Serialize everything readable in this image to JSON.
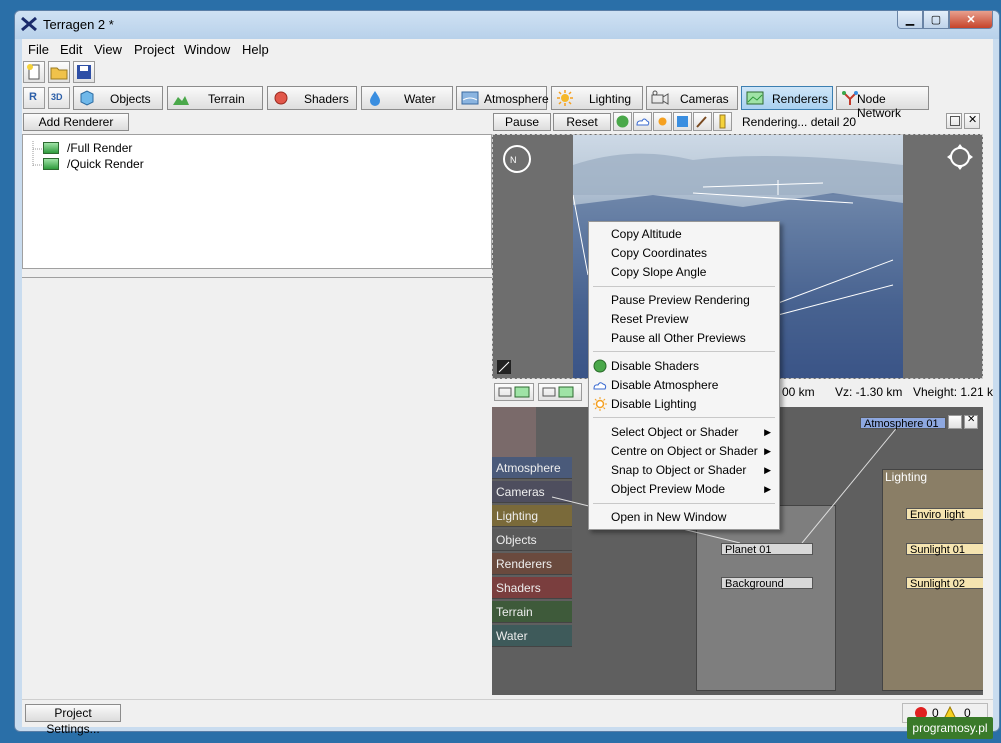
{
  "window": {
    "title": "Terragen 2 *"
  },
  "menu": [
    "File",
    "Edit",
    "View",
    "Project",
    "Window",
    "Help"
  ],
  "tabs": [
    {
      "label": "Objects",
      "icon": "cube-icon"
    },
    {
      "label": "Terrain",
      "icon": "terrain-icon"
    },
    {
      "label": "Shaders",
      "icon": "sphere-icon"
    },
    {
      "label": "Water",
      "icon": "droplet-icon"
    },
    {
      "label": "Atmosphere",
      "icon": "atmosphere-icon"
    },
    {
      "label": "Lighting",
      "icon": "sun-icon"
    },
    {
      "label": "Cameras",
      "icon": "camera-icon"
    },
    {
      "label": "Renderers",
      "icon": "renderer-icon"
    },
    {
      "label": "Node Network",
      "icon": "node-network-icon"
    }
  ],
  "left": {
    "add_renderer": "Add Renderer",
    "tree": [
      "/Full Render",
      "/Quick Render"
    ]
  },
  "preview": {
    "pause": "Pause",
    "reset": "Reset",
    "status": "Rendering... detail 20",
    "readout_1": "00 km",
    "readout_2": "Vz: -1.30 km",
    "readout_3": "Vheight: 1.21 k"
  },
  "context_menu": {
    "group1": [
      "Copy Altitude",
      "Copy Coordinates",
      "Copy Slope Angle"
    ],
    "group2": [
      "Pause Preview Rendering",
      "Reset Preview",
      "Pause all Other Previews"
    ],
    "group3": [
      "Disable Shaders",
      "Disable Atmosphere",
      "Disable Lighting"
    ],
    "group4": [
      "Select Object or Shader",
      "Centre on Object or Shader",
      "Snap to Object or Shader",
      "Object Preview Mode"
    ],
    "group5": [
      "Open in New Window"
    ]
  },
  "node_categories": [
    {
      "label": "Atmosphere",
      "color": "#4a5a7a"
    },
    {
      "label": "Cameras",
      "color": "#4e4e5e"
    },
    {
      "label": "Lighting",
      "color": "#7a6a3a"
    },
    {
      "label": "Objects",
      "color": "#5a5a5a"
    },
    {
      "label": "Renderers",
      "color": "#6a4a3e"
    },
    {
      "label": "Shaders",
      "color": "#7a3e3e"
    },
    {
      "label": "Terrain",
      "color": "#3e5a3a"
    },
    {
      "label": "Water",
      "color": "#3e5a5a"
    }
  ],
  "nodes": {
    "atmosphere": "Atmosphere 01",
    "planet": "Planet 01",
    "background": "Background",
    "lighting_group": "Lighting",
    "enviro": "Enviro light",
    "sun1": "Sunlight 01",
    "sun2": "Sunlight 02"
  },
  "bottom": {
    "project_settings": "Project Settings...",
    "errors": "0",
    "warnings": "0"
  },
  "watermark": "programosy.pl"
}
